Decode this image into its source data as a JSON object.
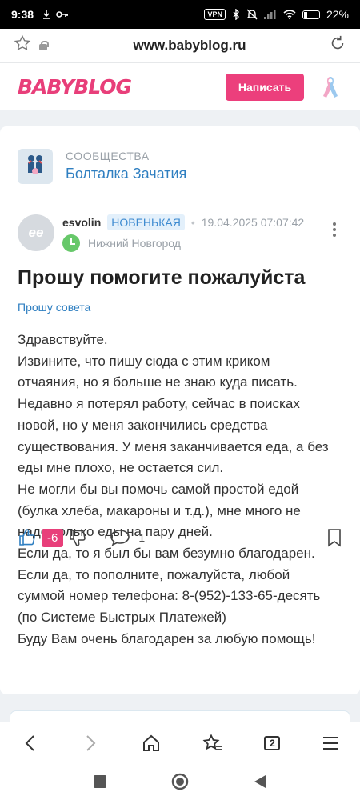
{
  "status": {
    "time": "9:38",
    "vpn": "VPN",
    "battery": "22%"
  },
  "browser": {
    "url": "www.babyblog.ru"
  },
  "site": {
    "logo": "BABYBLOG",
    "write_button": "Написать"
  },
  "community": {
    "label": "СООБЩЕСТВА",
    "name": "Болталка Зачатия"
  },
  "author": {
    "avatar_initials": "ее",
    "username": "esvolin",
    "badge": "НОВЕНЬКАЯ",
    "date": "19.04.2025 07:07:42",
    "city": "Нижний Новгород"
  },
  "post": {
    "title": "Прошу помогите пожалуйста",
    "tag": "Прошу совета",
    "lines": [
      "Здравствуйте.",
      "Извините, что пишу сюда с этим криком",
      "отчаяния, но я больше не знаю куда писать.",
      "Недавно я потерял работу, сейчас в поисках",
      "новой, но у меня закончились средства",
      "существования. У меня заканчивается еда, а без",
      "еды мне плохо, не остается сил.",
      "Не могли бы вы помочь самой простой едой",
      "(булка хлеба, макароны и т.д.), мне много не",
      "надо только еды на пару дней.",
      "Если да, то я был бы вам безумно благодарен.",
      "Если да, то пополните, пожалуйста, любой",
      "суммой номер телефона: 8-(952)-133-65-десять",
      "(по Системе Быстрых Платежей)",
      "Буду Вам очень благодарен за любую помощь!"
    ]
  },
  "actions": {
    "score": "-6",
    "comments": "1"
  },
  "bottom_nav": {
    "tabs_count": "2"
  },
  "colors": {
    "brand": "#e83f7a",
    "link": "#2f7fc1",
    "badge_bg": "#e3f0fb"
  }
}
